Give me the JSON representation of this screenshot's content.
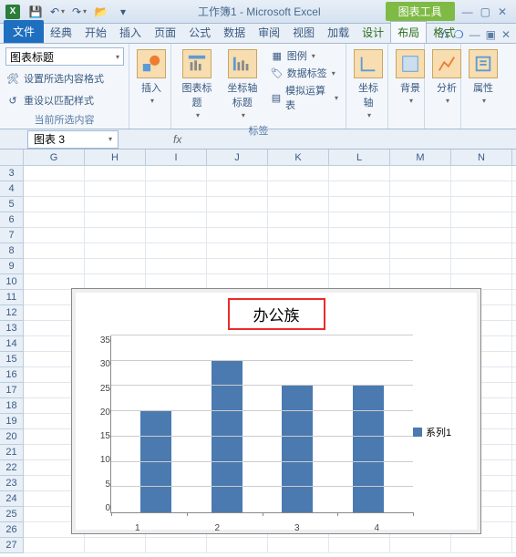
{
  "title": "工作簿1 - Microsoft Excel",
  "chart_tools_title": "图表工具",
  "tabs": {
    "file": "文件",
    "list": [
      "经典",
      "开始",
      "插入",
      "页面",
      "公式",
      "数据",
      "审阅",
      "视图",
      "加载",
      "设计",
      "布局",
      "格式"
    ],
    "active_index": 10
  },
  "ribbon": {
    "selection_dropdown": "图表标题",
    "set_sel_format": "设置所选内容格式",
    "reset_style": "重设以匹配样式",
    "group_selection": "当前所选内容",
    "insert": "插入",
    "chart_title_btn": "图表标题",
    "axis_title_btn": "坐标轴标题",
    "group_labels": "标签",
    "legend": "图例",
    "data_labels": "数据标签",
    "data_table": "模拟运算表",
    "axes": "坐标轴",
    "background": "背景",
    "analysis": "分析",
    "properties": "属性"
  },
  "namebox": "图表 3",
  "fx": "fx",
  "columns": [
    "G",
    "H",
    "I",
    "J",
    "K",
    "L",
    "M",
    "N"
  ],
  "rows_start": 3,
  "rows_end": 27,
  "chart_title_text": "办公族",
  "legend_label": "系列1",
  "chart_data": {
    "type": "bar",
    "categories": [
      "1",
      "2",
      "3",
      "4"
    ],
    "values": [
      20,
      30,
      25,
      25
    ],
    "title": "办公族",
    "xlabel": "",
    "ylabel": "",
    "ylim": [
      0,
      35
    ],
    "ytick_step": 5,
    "series_name": "系列1"
  }
}
